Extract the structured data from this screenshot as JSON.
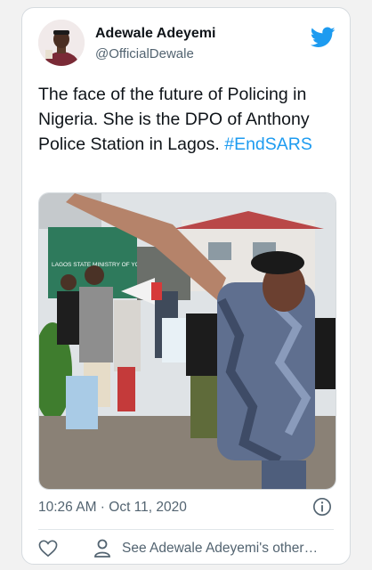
{
  "tweet": {
    "author_name": "Adewale Adeyemi",
    "author_handle": "@OfficialDewale",
    "text_main": "The face of the future of Policing in Nigeria. She is the DPO of Anthony Police Station in Lagos.",
    "hashtag": "#EndSARS",
    "timestamp": "10:26 AM · Oct 11, 2020",
    "profile_link": "See Adewale Adeyemi's other…",
    "photo_sign_text": "LAGOS STATE MINISTRY OF YOUTH"
  },
  "colors": {
    "accent": "#1d9bf0",
    "text_primary": "#0f1419",
    "text_secondary": "#536471"
  },
  "icons": {
    "brand": "twitter-bird-icon",
    "info": "info-icon",
    "like": "heart-icon",
    "profile": "user-icon"
  }
}
